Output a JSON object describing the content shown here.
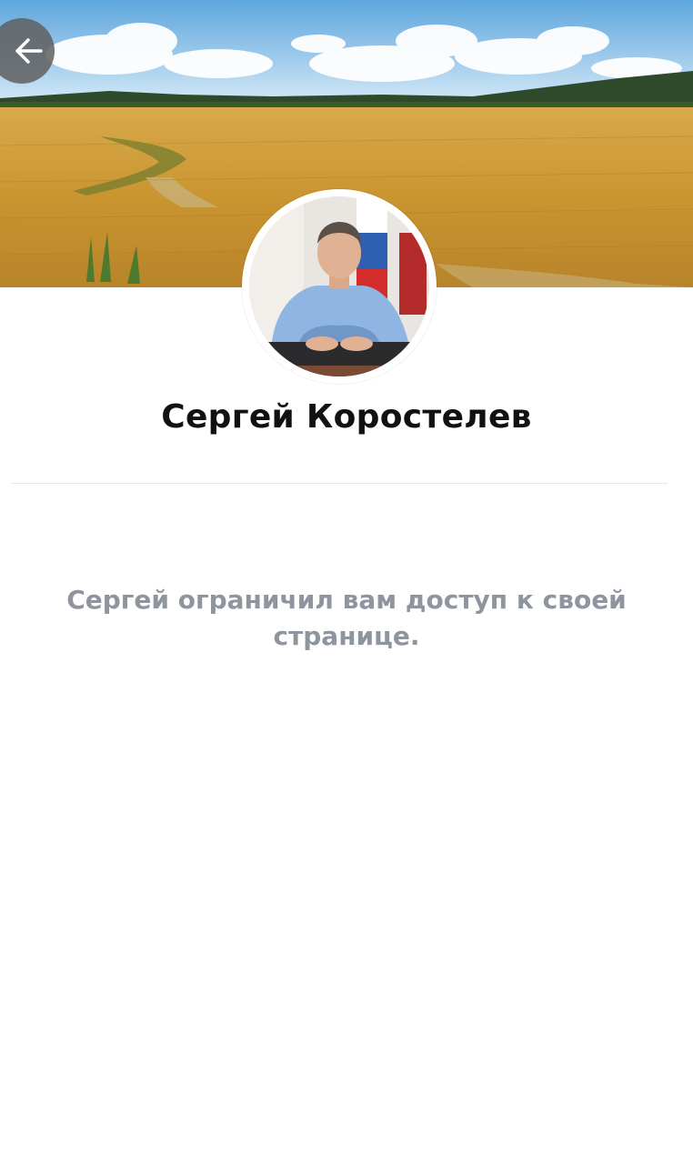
{
  "header": {
    "back_icon": "arrow-left-icon",
    "cover_image": "wheat-field-landscape"
  },
  "profile": {
    "name": "Сергей Коростелев",
    "avatar": "man-in-office-with-flag"
  },
  "message": {
    "text": "Сергей ограничил вам доступ к своей странице."
  },
  "colors": {
    "message_text": "#8e959e",
    "name_text": "#111111",
    "divider": "#e7e8ec"
  }
}
